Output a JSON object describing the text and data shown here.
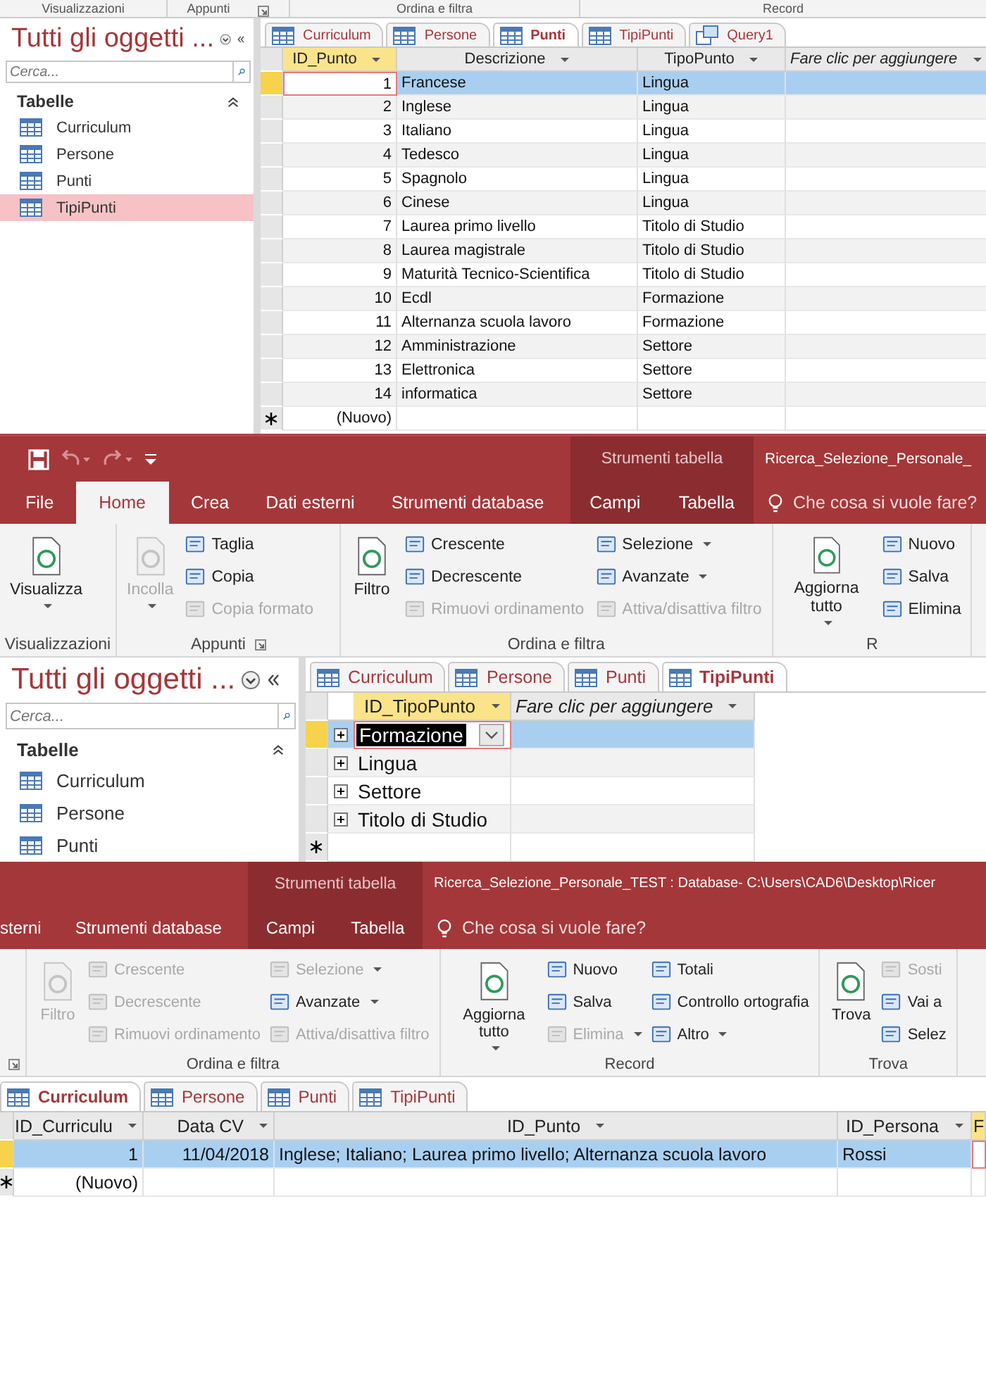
{
  "screens": [
    {
      "ribbon_group_labels": [
        {
          "label": "Visualizzazioni"
        },
        {
          "label": "Appunti",
          "launcher": true
        },
        {
          "label": "Ordina e filtra"
        },
        {
          "label": "Record"
        }
      ],
      "nav": {
        "title": "Tutti gli oggetti ...",
        "search_placeholder": "Cerca...",
        "group": "Tabelle",
        "items": [
          {
            "label": "Curriculum",
            "selected": false
          },
          {
            "label": "Persone",
            "selected": false
          },
          {
            "label": "Punti",
            "selected": false
          },
          {
            "label": "TipiPunti",
            "selected": true
          }
        ]
      },
      "doc_tabs": [
        {
          "label": "Curriculum",
          "selected": false,
          "kind": "table"
        },
        {
          "label": "Persone",
          "selected": false,
          "kind": "table"
        },
        {
          "label": "Punti",
          "selected": true,
          "kind": "table"
        },
        {
          "label": "TipiPunti",
          "selected": false,
          "kind": "table"
        },
        {
          "label": "Query1",
          "selected": false,
          "kind": "query"
        }
      ],
      "table": {
        "expandable": false,
        "columns": [
          {
            "label": "ID_Punto",
            "kind": "number",
            "active": true
          },
          {
            "label": "Descrizione",
            "kind": "text",
            "active": false
          },
          {
            "label": "TipoPunto",
            "kind": "text",
            "active": false
          },
          {
            "label": "Fare clic per aggiungere",
            "kind": "add",
            "active": false
          }
        ],
        "rows": [
          {
            "cells": [
              "1",
              "Francese",
              "Lingua"
            ],
            "selected": true
          },
          {
            "cells": [
              "2",
              "Inglese",
              "Lingua"
            ],
            "selected": false
          },
          {
            "cells": [
              "3",
              "Italiano",
              "Lingua"
            ],
            "selected": false
          },
          {
            "cells": [
              "4",
              "Tedesco",
              "Lingua"
            ],
            "selected": false
          },
          {
            "cells": [
              "5",
              "Spagnolo",
              "Lingua"
            ],
            "selected": false
          },
          {
            "cells": [
              "6",
              "Cinese",
              "Lingua"
            ],
            "selected": false
          },
          {
            "cells": [
              "7",
              "Laurea primo livello",
              "Titolo di Studio"
            ],
            "selected": false
          },
          {
            "cells": [
              "8",
              "Laurea magistrale",
              "Titolo di Studio"
            ],
            "selected": false
          },
          {
            "cells": [
              "9",
              "Maturità Tecnico-Scientifica",
              "Titolo di Studio"
            ],
            "selected": false
          },
          {
            "cells": [
              "10",
              "Ecdl",
              "Formazione"
            ],
            "selected": false
          },
          {
            "cells": [
              "11",
              "Alternanza scuola lavoro",
              "Formazione"
            ],
            "selected": false
          },
          {
            "cells": [
              "12",
              "Amministrazione",
              "Settore"
            ],
            "selected": false
          },
          {
            "cells": [
              "13",
              "Elettronica",
              "Settore"
            ],
            "selected": false
          },
          {
            "cells": [
              "14",
              "informatica",
              "Settore"
            ],
            "selected": false
          }
        ],
        "new_row": true,
        "new_row_label": "(Nuovo)"
      }
    },
    {
      "title_bar": {
        "quick_access": true,
        "context_label": "Strumenti tabella",
        "title": "Ricerca_Selezione_Personale_"
      },
      "menu_tabs": [
        {
          "label": "File",
          "selected": false,
          "contextual": false
        },
        {
          "label": "Home",
          "selected": true,
          "contextual": false
        },
        {
          "label": "Crea",
          "selected": false,
          "contextual": false
        },
        {
          "label": "Dati esterni",
          "selected": false,
          "contextual": false
        },
        {
          "label": "Strumenti database",
          "selected": false,
          "contextual": false
        },
        {
          "label": "Campi",
          "selected": false,
          "contextual": true
        },
        {
          "label": "Tabella",
          "selected": false,
          "contextual": true
        }
      ],
      "tell_me": "Che cosa si vuole fare?",
      "ribbon": [
        {
          "label": "Visualizzazioni",
          "launcher": false,
          "columns": [
            [
              {
                "label": "Visualizza",
                "kind": "large",
                "disabled": false,
                "dropdown": true
              }
            ]
          ]
        },
        {
          "label": "Appunti",
          "launcher": true,
          "columns": [
            [
              {
                "label": "Incolla",
                "kind": "large",
                "disabled": true,
                "dropdown": true
              }
            ],
            [
              {
                "label": "Taglia",
                "kind": "small",
                "disabled": false,
                "dropdown": false
              },
              {
                "label": "Copia",
                "kind": "small",
                "disabled": false,
                "dropdown": false
              },
              {
                "label": "Copia formato",
                "kind": "small",
                "disabled": true,
                "dropdown": false
              }
            ]
          ]
        },
        {
          "label": "Ordina e filtra",
          "launcher": false,
          "columns": [
            [
              {
                "label": "Filtro",
                "kind": "large",
                "disabled": false,
                "dropdown": false
              }
            ],
            [
              {
                "label": "Crescente",
                "kind": "small",
                "disabled": false,
                "dropdown": false
              },
              {
                "label": "Decrescente",
                "kind": "small",
                "disabled": false,
                "dropdown": false
              },
              {
                "label": "Rimuovi ordinamento",
                "kind": "small",
                "disabled": true,
                "dropdown": false
              }
            ],
            [
              {
                "label": "Selezione",
                "kind": "small",
                "disabled": false,
                "dropdown": true
              },
              {
                "label": "Avanzate",
                "kind": "small",
                "disabled": false,
                "dropdown": true
              },
              {
                "label": "Attiva/disattiva filtro",
                "kind": "small",
                "disabled": true,
                "dropdown": false
              }
            ]
          ]
        },
        {
          "label": "R",
          "launcher": false,
          "columns": [
            [
              {
                "label": "Aggiorna tutto",
                "kind": "large",
                "disabled": false,
                "dropdown": true
              }
            ],
            [
              {
                "label": "Nuovo",
                "kind": "small",
                "disabled": false,
                "dropdown": false
              },
              {
                "label": "Salva",
                "kind": "small",
                "disabled": false,
                "dropdown": false
              },
              {
                "label": "Elimina",
                "kind": "small",
                "disabled": false,
                "dropdown": false
              }
            ]
          ]
        }
      ],
      "nav": {
        "title": "Tutti gli oggetti ...",
        "search_placeholder": "Cerca...",
        "group": "Tabelle",
        "items": [
          {
            "label": "Curriculum",
            "selected": false
          },
          {
            "label": "Persone",
            "selected": false
          },
          {
            "label": "Punti",
            "selected": false
          }
        ]
      },
      "doc_tabs": [
        {
          "label": "Curriculum",
          "selected": false,
          "kind": "table"
        },
        {
          "label": "Persone",
          "selected": false,
          "kind": "table"
        },
        {
          "label": "Punti",
          "selected": false,
          "kind": "table"
        },
        {
          "label": "TipiPunti",
          "selected": true,
          "kind": "table"
        }
      ],
      "table": {
        "expandable": true,
        "columns": [
          {
            "label": "ID_TipoPunto",
            "kind": "lookup",
            "active": true
          },
          {
            "label": "Fare clic per aggiungere",
            "kind": "add",
            "active": false
          }
        ],
        "rows": [
          {
            "cells": [
              "Formazione"
            ],
            "selected": true,
            "expanded": false
          },
          {
            "cells": [
              "Lingua"
            ],
            "selected": false,
            "expanded": false
          },
          {
            "cells": [
              "Settore"
            ],
            "selected": false,
            "expanded": false
          },
          {
            "cells": [
              "Titolo di Studio"
            ],
            "selected": false,
            "expanded": false
          }
        ],
        "new_row": true
      }
    },
    {
      "title_bar": {
        "quick_access": false,
        "context_label": "Strumenti tabella",
        "title": "Ricerca_Selezione_Personale_TEST : Database- C:\\Users\\CAD6\\Desktop\\Ricer"
      },
      "menu_tabs": [
        {
          "label": "sterni",
          "selected": false,
          "contextual": false
        },
        {
          "label": "Strumenti database",
          "selected": false,
          "contextual": false
        },
        {
          "label": "Campi",
          "selected": false,
          "contextual": true
        },
        {
          "label": "Tabella",
          "selected": false,
          "contextual": true
        }
      ],
      "tell_me": "Che cosa si vuole fare?",
      "ribbon": [
        {
          "launcher": true
        },
        {
          "label": "Ordina e filtra",
          "launcher": false,
          "columns": [
            [
              {
                "label": "Filtro",
                "kind": "large",
                "disabled": true,
                "dropdown": false
              }
            ],
            [
              {
                "label": "Crescente",
                "kind": "small",
                "disabled": true,
                "dropdown": false
              },
              {
                "label": "Decrescente",
                "kind": "small",
                "disabled": true,
                "dropdown": false
              },
              {
                "label": "Rimuovi ordinamento",
                "kind": "small",
                "disabled": true,
                "dropdown": false
              }
            ],
            [
              {
                "label": "Selezione",
                "kind": "small",
                "disabled": true,
                "dropdown": true
              },
              {
                "label": "Avanzate",
                "kind": "small",
                "disabled": false,
                "dropdown": true
              },
              {
                "label": "Attiva/disattiva filtro",
                "kind": "small",
                "disabled": true,
                "dropdown": false
              }
            ]
          ]
        },
        {
          "label": "Record",
          "launcher": false,
          "columns": [
            [
              {
                "label": "Aggiorna tutto",
                "kind": "large",
                "disabled": false,
                "dropdown": true
              }
            ],
            [
              {
                "label": "Nuovo",
                "kind": "small",
                "disabled": false,
                "dropdown": false
              },
              {
                "label": "Salva",
                "kind": "small",
                "disabled": false,
                "dropdown": false
              },
              {
                "label": "Elimina",
                "kind": "small",
                "disabled": true,
                "dropdown": true
              }
            ],
            [
              {
                "label": "Totali",
                "kind": "small",
                "disabled": false,
                "dropdown": false
              },
              {
                "label": "Controllo ortografia",
                "kind": "small",
                "disabled": false,
                "dropdown": false
              },
              {
                "label": "Altro",
                "kind": "small",
                "disabled": false,
                "dropdown": true
              }
            ]
          ]
        },
        {
          "label": "Trova",
          "launcher": false,
          "columns": [
            [
              {
                "label": "Trova",
                "kind": "large",
                "disabled": false,
                "dropdown": false
              }
            ],
            [
              {
                "label": "Sosti",
                "kind": "small",
                "disabled": true,
                "dropdown": false
              },
              {
                "label": "Vai a",
                "kind": "small",
                "disabled": false,
                "dropdown": false
              },
              {
                "label": "Selez",
                "kind": "small",
                "disabled": false,
                "dropdown": false
              }
            ]
          ]
        }
      ],
      "doc_tabs": [
        {
          "label": "Curriculum",
          "selected": true,
          "kind": "table"
        },
        {
          "label": "Persone",
          "selected": false,
          "kind": "table"
        },
        {
          "label": "Punti",
          "selected": false,
          "kind": "table"
        },
        {
          "label": "TipiPunti",
          "selected": false,
          "kind": "table"
        }
      ],
      "table": {
        "expandable": false,
        "columns": [
          {
            "label": "ID_Curriculu",
            "kind": "number",
            "active": false
          },
          {
            "label": "Data CV",
            "kind": "number",
            "active": false
          },
          {
            "label": "ID_Punto",
            "kind": "text",
            "active": false
          },
          {
            "label": "ID_Persona",
            "kind": "text",
            "active": false
          },
          {
            "label": "F",
            "kind": "text",
            "active": true
          }
        ],
        "rows": [
          {
            "cells": [
              "1",
              "11/04/2018",
              "Inglese; Italiano; Laurea primo livello; Alternanza scuola lavoro",
              "Rossi"
            ],
            "selected": true
          }
        ],
        "new_row": true,
        "new_row_label": "(Nuovo)"
      }
    }
  ]
}
